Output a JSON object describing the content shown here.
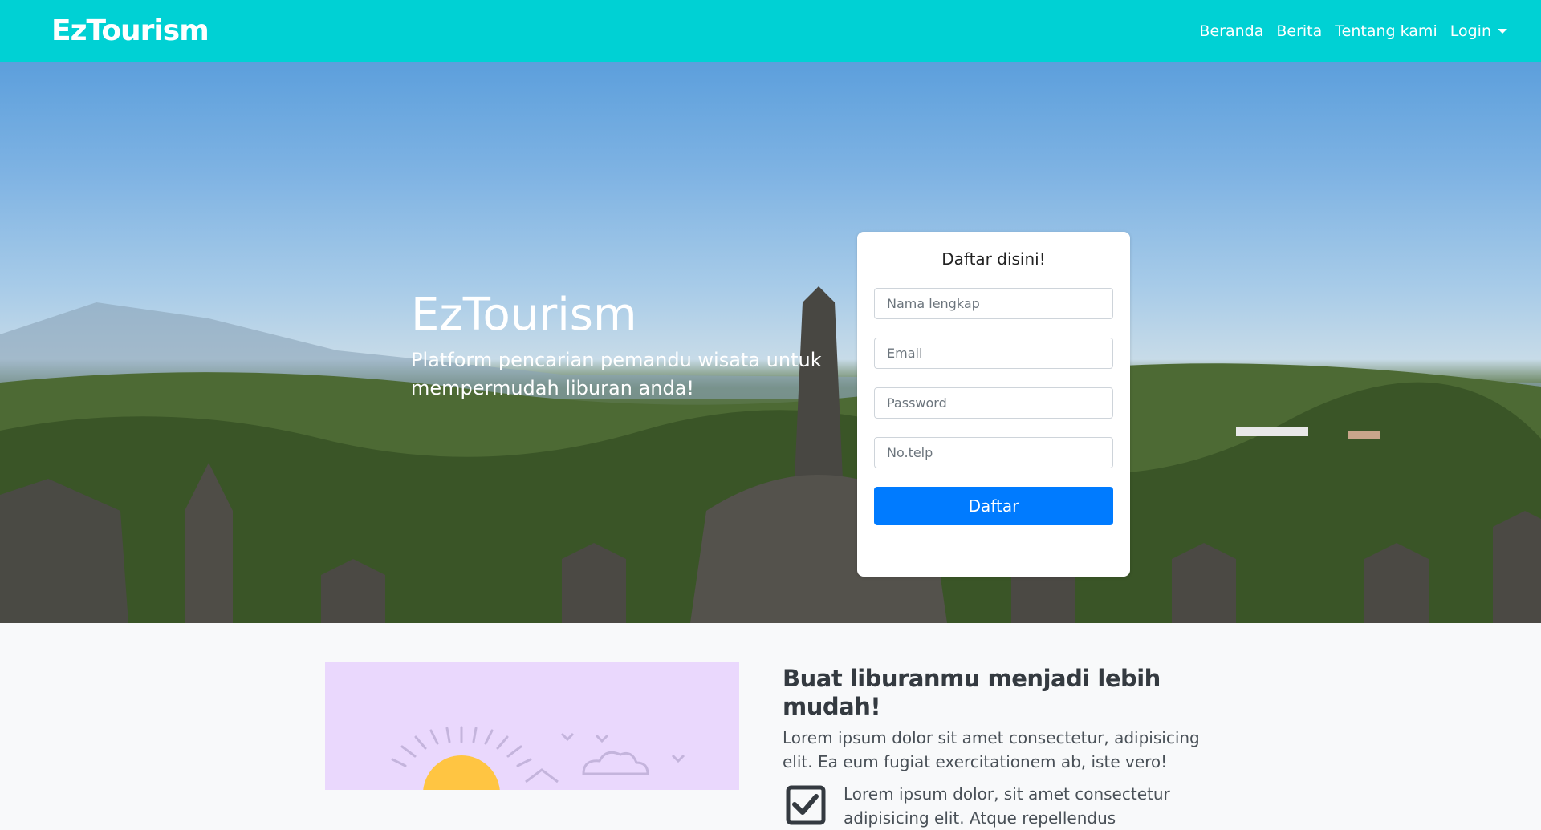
{
  "navbar": {
    "brand": "EzTourism",
    "links": [
      "Beranda",
      "Berita",
      "Tentang kami"
    ],
    "login": "Login"
  },
  "hero": {
    "title": "EzTourism",
    "subtitle": "Platform pencarian pemandu wisata untuk mempermudah liburan anda!"
  },
  "register": {
    "title": "Daftar disini!",
    "name_placeholder": "Nama lengkap",
    "email_placeholder": "Email",
    "password_placeholder": "Password",
    "phone_placeholder": "No.telp",
    "submit": "Daftar"
  },
  "feature": {
    "title": "Buat liburanmu menjadi lebih mudah!",
    "text": "Lorem ipsum dolor sit amet consectetur, adipisicing elit. Ea eum fugiat exercitationem ab, iste vero!",
    "item": "Lorem ipsum dolor, sit amet consectetur adipisicing elit. Atque repellendus"
  },
  "colors": {
    "navbar": "#00d1d4",
    "primary": "#007bff",
    "illustration_bg": "#ead8fd"
  },
  "icons": [
    "caret-down-icon",
    "checkbox-checked-icon",
    "sun-illustration",
    "cloud-illustration"
  ]
}
